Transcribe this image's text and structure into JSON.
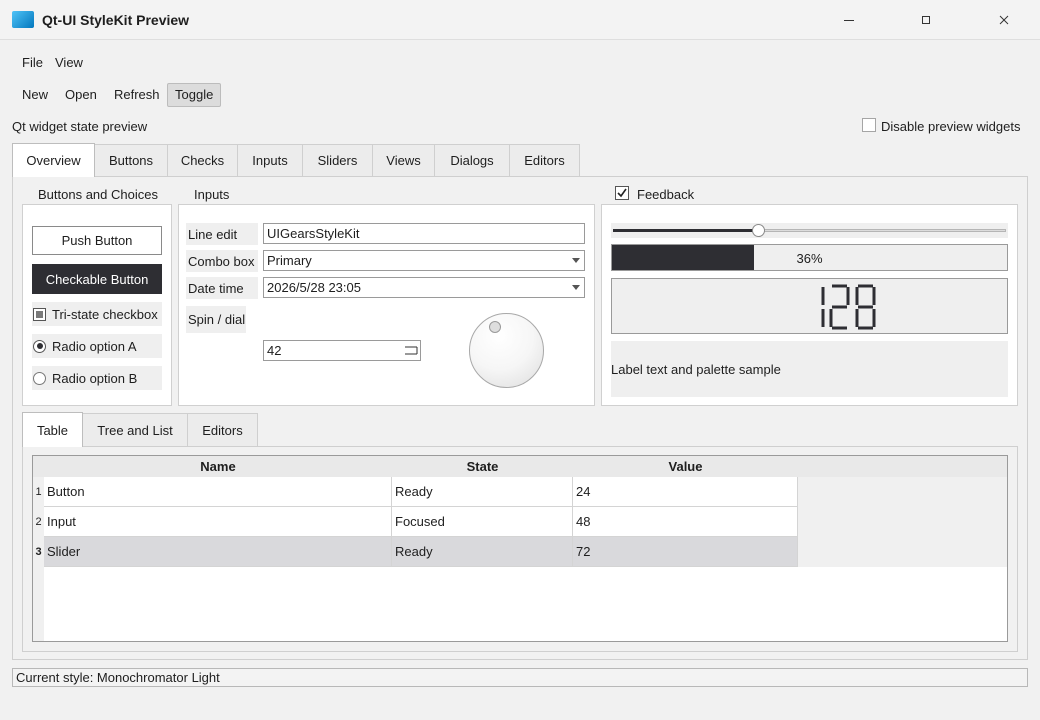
{
  "window": {
    "title": "Qt-UI StyleKit Preview"
  },
  "menu": {
    "file": "File",
    "view": "View"
  },
  "toolbar": {
    "new": "New",
    "open": "Open",
    "refresh": "Refresh",
    "toggle": "Toggle"
  },
  "header": {
    "preview_label": "Qt widget state preview",
    "disable_label": "Disable preview widgets"
  },
  "tabs": [
    "Overview",
    "Buttons",
    "Checks",
    "Inputs",
    "Sliders",
    "Views",
    "Dialogs",
    "Editors"
  ],
  "groups": {
    "buttons": {
      "title": "Buttons and Choices",
      "push": "Push Button",
      "checkable": "Checkable Button",
      "tristate": "Tri-state checkbox",
      "radio_a": "Radio option A",
      "radio_b": "Radio option B"
    },
    "inputs": {
      "title": "Inputs",
      "line_edit_label": "Line edit",
      "line_edit_value": "UIGearsStyleKit",
      "combo_label": "Combo box",
      "combo_value": "Primary",
      "datetime_label": "Date time",
      "datetime_value": "2026/5/28 23:05",
      "spin_label": "Spin / dial",
      "spin_value": "42"
    },
    "feedback": {
      "title": "Feedback",
      "slider_fraction": 0.37,
      "progress_percent": 36,
      "progress_text": "36%",
      "lcd_value": "128",
      "label_sample": "Label text and palette sample"
    }
  },
  "subtabs": [
    "Table",
    "Tree and List",
    "Editors"
  ],
  "table": {
    "headers": [
      "Name",
      "State",
      "Value"
    ],
    "rows": [
      {
        "num": "1",
        "name": "Button",
        "state": "Ready",
        "value": "24"
      },
      {
        "num": "2",
        "name": "Input",
        "state": "Focused",
        "value": "48"
      },
      {
        "num": "3",
        "name": "Slider",
        "state": "Ready",
        "value": "72"
      }
    ]
  },
  "status": {
    "text": "Current style: Monochromator Light"
  },
  "colors": {
    "dark_button": "#2e2e33",
    "progress_fill": "#2e2e33",
    "selected_row": "#d9d9dc"
  }
}
